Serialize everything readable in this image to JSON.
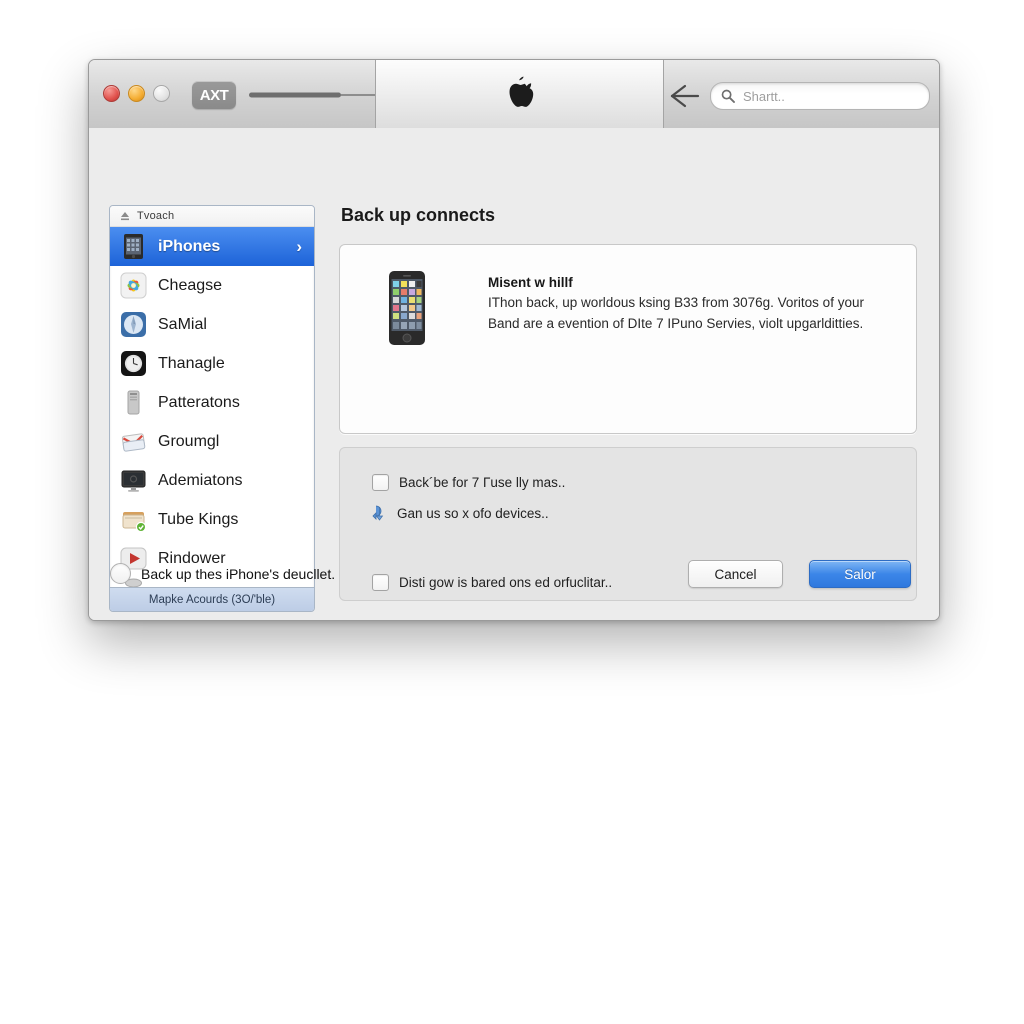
{
  "window": {
    "traffic_lights": [
      "close",
      "minimize",
      "zoom"
    ],
    "toolbar": {
      "badge_label": "AXT",
      "progress_arrow_icon": "long-right-arrow-icon",
      "tab_icon": "apple-logo-icon",
      "back_icon": "back-arrow-icon"
    },
    "search": {
      "icon": "search-icon",
      "placeholder": "Shartt..",
      "value": ""
    }
  },
  "sidebar": {
    "header": {
      "icon": "device-eject-icon",
      "label": "Tvoach"
    },
    "items": [
      {
        "label": "iPhones",
        "icon": "iphone-device-icon",
        "selected": true,
        "chevron": "›"
      },
      {
        "label": "Cheagse",
        "icon": "photos-icon",
        "selected": false,
        "chevron": ""
      },
      {
        "label": "SaMial",
        "icon": "safari-compass-icon",
        "selected": false,
        "chevron": ""
      },
      {
        "label": "Thanagle",
        "icon": "clock-icon",
        "selected": false,
        "chevron": ""
      },
      {
        "label": "Patteratons",
        "icon": "server-tower-icon",
        "selected": false,
        "chevron": ""
      },
      {
        "label": "Groumgl",
        "icon": "mail-stack-icon",
        "selected": false,
        "chevron": ""
      },
      {
        "label": "Ademiatons",
        "icon": "display-monitor-icon",
        "selected": false,
        "chevron": ""
      },
      {
        "label": "Tube Kings",
        "icon": "folder-sync-icon",
        "selected": false,
        "chevron": ""
      },
      {
        "label": "Rindower",
        "icon": "play-media-icon",
        "selected": false,
        "chevron": ""
      }
    ],
    "footer_label": "Mapke Acourds (3O/'ble)"
  },
  "main": {
    "title": "Back up connects",
    "info_card": {
      "device_icon": "iphone-photo-icon",
      "heading": "Misent w hillf",
      "body": "IThon back, up worldous ksing B33 from 3076g. Voritos of your Band are a evention of DIte 7 IPuno Servies, violt upgarlditties."
    },
    "options": [
      {
        "control": "checkbox",
        "checked": false,
        "label": "Back´be for 7 Гuse lly mas.."
      },
      {
        "control": "sync-icon",
        "checked": false,
        "label": "Gan us so x ofo devices.."
      },
      {
        "control": "checkbox",
        "checked": false,
        "label": "Disti gow is bared ons ed orfuclitar.."
      }
    ]
  },
  "bottom": {
    "radio": {
      "checked": false,
      "label": "Back up thes iPhone's deucllet."
    },
    "cancel_label": "Cancel",
    "save_label": "Salor"
  },
  "colors": {
    "accent_blue": "#2f78de",
    "selection_blue": "#1d63d8",
    "window_bg": "#ececec",
    "card_bg": "#fdfdfd",
    "options_bg": "#e4e4e4"
  }
}
